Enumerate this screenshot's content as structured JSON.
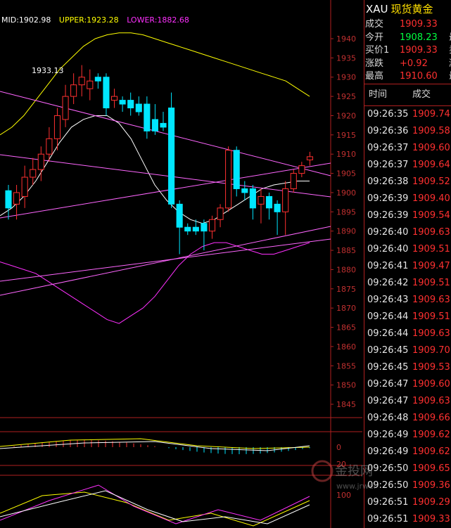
{
  "legend": {
    "mid": "MID:1902.98",
    "upper": "UPPER:1923.28",
    "lower": "LOWER:1882.68",
    "mid_color": "#ffffff",
    "upper_color": "#ffff00",
    "lower_color": "#ff30ff"
  },
  "annotation_high": "1933.13",
  "sidebar": {
    "symbol": "XAU",
    "symbol_cn": "现货黄金",
    "quotes": [
      {
        "label": "成交",
        "value": "1909.33",
        "value_color": "#ff3030",
        "extra": ""
      },
      {
        "label": "今开",
        "value": "1908.23",
        "value_color": "#00ff40",
        "extra": "最"
      },
      {
        "label": "买价1",
        "value": "1909.33",
        "value_color": "#ff3030",
        "extra": "卖"
      },
      {
        "label": "涨跌",
        "value": "+0.92",
        "value_color": "#ff3030",
        "extra": "涨"
      },
      {
        "label": "最高",
        "value": "1910.60",
        "value_color": "#ff3030",
        "extra": "最"
      }
    ],
    "table_header": {
      "time": "时间",
      "price": "成交"
    },
    "ticks": [
      {
        "time": "09:26:35",
        "price": "1909.74"
      },
      {
        "time": "09:26:36",
        "price": "1909.58"
      },
      {
        "time": "09:26:37",
        "price": "1909.60"
      },
      {
        "time": "09:26:37",
        "price": "1909.64"
      },
      {
        "time": "09:26:38",
        "price": "1909.52"
      },
      {
        "time": "09:26:39",
        "price": "1909.40"
      },
      {
        "time": "09:26:39",
        "price": "1909.54"
      },
      {
        "time": "09:26:40",
        "price": "1909.63"
      },
      {
        "time": "09:26:40",
        "price": "1909.51"
      },
      {
        "time": "09:26:41",
        "price": "1909.47"
      },
      {
        "time": "09:26:42",
        "price": "1909.51"
      },
      {
        "time": "09:26:43",
        "price": "1909.63"
      },
      {
        "time": "09:26:44",
        "price": "1909.51"
      },
      {
        "time": "09:26:44",
        "price": "1909.63"
      },
      {
        "time": "09:26:45",
        "price": "1909.70"
      },
      {
        "time": "09:26:45",
        "price": "1909.53"
      },
      {
        "time": "09:26:47",
        "price": "1909.60"
      },
      {
        "time": "09:26:47",
        "price": "1909.63"
      },
      {
        "time": "09:26:48",
        "price": "1909.66"
      },
      {
        "time": "09:26:49",
        "price": "1909.62"
      },
      {
        "time": "09:26:49",
        "price": "1909.62"
      },
      {
        "time": "09:26:50",
        "price": "1909.65"
      },
      {
        "time": "09:26:50",
        "price": "1909.36"
      },
      {
        "time": "09:26:51",
        "price": "1909.29"
      },
      {
        "time": "09:26:51",
        "price": "1909.33"
      }
    ]
  },
  "watermark": {
    "text": "金投网",
    "url_text": "www.jrwei.com"
  },
  "chart_data": {
    "type": "candlestick",
    "title": "",
    "y_ticks": [
      1940,
      1935,
      1930,
      1925,
      1920,
      1915,
      1910,
      1905,
      1900,
      1895,
      1890,
      1885,
      1880,
      1875,
      1870,
      1865,
      1860,
      1855,
      1850,
      1845
    ],
    "ylim": [
      1842,
      1942
    ],
    "macd_ticks": [
      "0",
      "20"
    ],
    "stoch_ticks": [
      "100"
    ],
    "up_color": "#ff3030",
    "down_color": "#00e6ff",
    "candles": [
      {
        "o": 1900.5,
        "h": 1902.0,
        "l": 1893.0,
        "c": 1896.0
      },
      {
        "o": 1897.0,
        "h": 1902.0,
        "l": 1893.0,
        "c": 1900.0
      },
      {
        "o": 1899.0,
        "h": 1907.0,
        "l": 1896.0,
        "c": 1904.0
      },
      {
        "o": 1904.0,
        "h": 1909.0,
        "l": 1902.0,
        "c": 1906.0
      },
      {
        "o": 1906.0,
        "h": 1912.0,
        "l": 1903.0,
        "c": 1910.0
      },
      {
        "o": 1910.0,
        "h": 1917.0,
        "l": 1908.0,
        "c": 1914.0
      },
      {
        "o": 1914.0,
        "h": 1922.0,
        "l": 1911.0,
        "c": 1920.0
      },
      {
        "o": 1919.0,
        "h": 1928.0,
        "l": 1917.0,
        "c": 1925.0
      },
      {
        "o": 1925.0,
        "h": 1931.0,
        "l": 1923.0,
        "c": 1928.0
      },
      {
        "o": 1928.0,
        "h": 1933.13,
        "l": 1925.0,
        "c": 1930.0
      },
      {
        "o": 1927.0,
        "h": 1932.0,
        "l": 1924.0,
        "c": 1929.0
      },
      {
        "o": 1930.0,
        "h": 1931.0,
        "l": 1927.0,
        "c": 1929.0
      },
      {
        "o": 1930.0,
        "h": 1931.0,
        "l": 1920.0,
        "c": 1922.0
      },
      {
        "o": 1924.0,
        "h": 1927.0,
        "l": 1922.0,
        "c": 1925.0
      },
      {
        "o": 1924.0,
        "h": 1925.0,
        "l": 1921.0,
        "c": 1923.0
      },
      {
        "o": 1924.0,
        "h": 1926.0,
        "l": 1920.0,
        "c": 1922.0
      },
      {
        "o": 1923.0,
        "h": 1925.0,
        "l": 1920.0,
        "c": 1921.0
      },
      {
        "o": 1923.0,
        "h": 1925.0,
        "l": 1914.0,
        "c": 1916.0
      },
      {
        "o": 1919.0,
        "h": 1923.0,
        "l": 1915.0,
        "c": 1916.0
      },
      {
        "o": 1918.0,
        "h": 1921.0,
        "l": 1916.0,
        "c": 1917.0
      },
      {
        "o": 1922.0,
        "h": 1926.0,
        "l": 1896.0,
        "c": 1897.0
      },
      {
        "o": 1897.0,
        "h": 1898.0,
        "l": 1884.0,
        "c": 1891.0
      },
      {
        "o": 1891.0,
        "h": 1892.0,
        "l": 1889.0,
        "c": 1890.0
      },
      {
        "o": 1891.0,
        "h": 1893.0,
        "l": 1889.0,
        "c": 1890.0
      },
      {
        "o": 1892.0,
        "h": 1893.0,
        "l": 1885.0,
        "c": 1890.0
      },
      {
        "o": 1890.0,
        "h": 1894.0,
        "l": 1888.0,
        "c": 1893.0
      },
      {
        "o": 1893.0,
        "h": 1897.0,
        "l": 1891.0,
        "c": 1896.0
      },
      {
        "o": 1896.0,
        "h": 1912.0,
        "l": 1895.0,
        "c": 1911.0
      },
      {
        "o": 1911.0,
        "h": 1912.0,
        "l": 1899.0,
        "c": 1901.0
      },
      {
        "o": 1901.0,
        "h": 1903.0,
        "l": 1898.0,
        "c": 1900.0
      },
      {
        "o": 1901.0,
        "h": 1902.0,
        "l": 1893.0,
        "c": 1896.0
      },
      {
        "o": 1897.0,
        "h": 1901.0,
        "l": 1892.0,
        "c": 1899.0
      },
      {
        "o": 1899.0,
        "h": 1900.0,
        "l": 1893.0,
        "c": 1896.0
      },
      {
        "o": 1897.0,
        "h": 1898.0,
        "l": 1889.0,
        "c": 1895.0
      },
      {
        "o": 1895.0,
        "h": 1903.0,
        "l": 1889.0,
        "c": 1901.0
      },
      {
        "o": 1901.0,
        "h": 1906.0,
        "l": 1900.0,
        "c": 1905.0
      },
      {
        "o": 1905.0,
        "h": 1908.0,
        "l": 1904.0,
        "c": 1907.0
      },
      {
        "o": 1908.5,
        "h": 1910.6,
        "l": 1907.0,
        "c": 1909.33
      }
    ],
    "upper_band": [
      1915,
      1917,
      1920,
      1924,
      1928,
      1932,
      1935,
      1938,
      1940,
      1941,
      1941.5,
      1941.5,
      1941,
      1940,
      1939,
      1938,
      1937,
      1936,
      1935,
      1934,
      1933,
      1932,
      1931,
      1930,
      1929,
      1927,
      1925
    ],
    "lower_band": [
      1882,
      1881,
      1880,
      1879,
      1877,
      1875,
      1873,
      1871,
      1869,
      1867,
      1866,
      1868,
      1870,
      1873,
      1877,
      1881,
      1884,
      1886,
      1887,
      1887,
      1886,
      1885,
      1884,
      1884,
      1885,
      1886,
      1887
    ],
    "mid_band": [
      1894,
      1896,
      1899,
      1903,
      1908,
      1913,
      1917,
      1919,
      1920,
      1920,
      1918,
      1914,
      1908,
      1902,
      1898,
      1895,
      1893,
      1892,
      1893,
      1895,
      1897,
      1899,
      1901,
      1902,
      1902.5,
      1903,
      1903
    ]
  }
}
